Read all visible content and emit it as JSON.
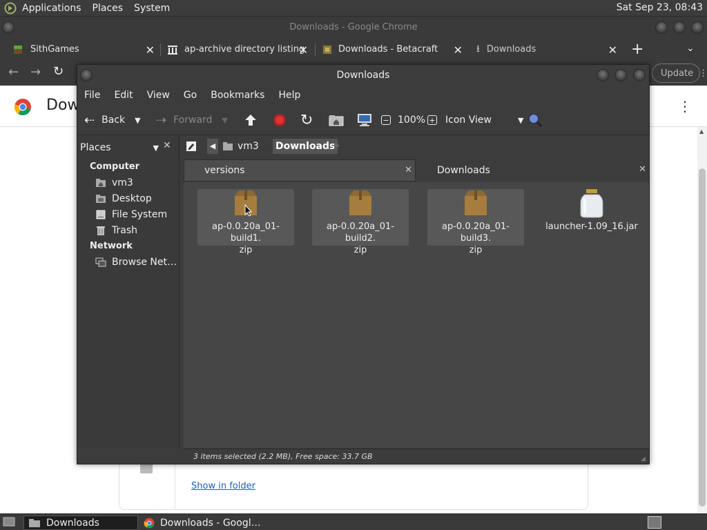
{
  "top_panel": {
    "menus": [
      "Applications",
      "Places",
      "System"
    ],
    "clock": "Sat Sep 23, 08:43"
  },
  "chrome": {
    "window_title": "Downloads - Google Chrome",
    "tabs": [
      {
        "label": "SithGames",
        "icon": "minecraft-grass-icon"
      },
      {
        "label": "ap-archive directory listing",
        "icon": "archive-building-icon"
      },
      {
        "label": "Downloads - Betacraft",
        "icon": "betacraft-icon"
      },
      {
        "label": "Downloads",
        "icon": "download-icon"
      }
    ],
    "update_label": "Update",
    "page_title": "Dow",
    "show_in_folder": "Show in folder"
  },
  "caja": {
    "title": "Downloads",
    "menu": [
      "File",
      "Edit",
      "View",
      "Go",
      "Bookmarks",
      "Help"
    ],
    "toolbar": {
      "back": "Back",
      "forward": "Forward",
      "zoom": "100%",
      "view_mode": "Icon View"
    },
    "sidebar": {
      "combo_label": "Places",
      "sections": [
        {
          "heading": "Computer",
          "items": [
            {
              "label": "vm3",
              "icon": "home-folder-icon"
            },
            {
              "label": "Desktop",
              "icon": "desktop-folder-icon"
            },
            {
              "label": "File System",
              "icon": "drive-icon"
            },
            {
              "label": "Trash",
              "icon": "trash-icon"
            }
          ]
        },
        {
          "heading": "Network",
          "items": [
            {
              "label": "Browse Net…",
              "icon": "network-icon"
            }
          ]
        }
      ]
    },
    "path": [
      "vm3",
      "Downloads"
    ],
    "tabs": [
      {
        "label": "versions"
      },
      {
        "label": "Downloads"
      }
    ],
    "files": [
      {
        "line1": "ap-0.0.20a_01-build1.",
        "line2": "zip",
        "selected": true,
        "type": "zip"
      },
      {
        "line1": "ap-0.0.20a_01-build2.",
        "line2": "zip",
        "selected": true,
        "type": "zip"
      },
      {
        "line1": "ap-0.0.20a_01-build3.",
        "line2": "zip",
        "selected": true,
        "type": "zip"
      },
      {
        "line1": "launcher-1.09_16.jar",
        "line2": "",
        "selected": false,
        "type": "jar"
      }
    ],
    "status": "3 items selected (2.2 MB), Free space: 33.7 GB"
  },
  "taskbar": {
    "tasks": [
      {
        "label": "Downloads",
        "icon": "folder-icon",
        "active": true
      },
      {
        "label": "Downloads - Googl…",
        "icon": "chrome-icon",
        "active": false
      }
    ]
  }
}
